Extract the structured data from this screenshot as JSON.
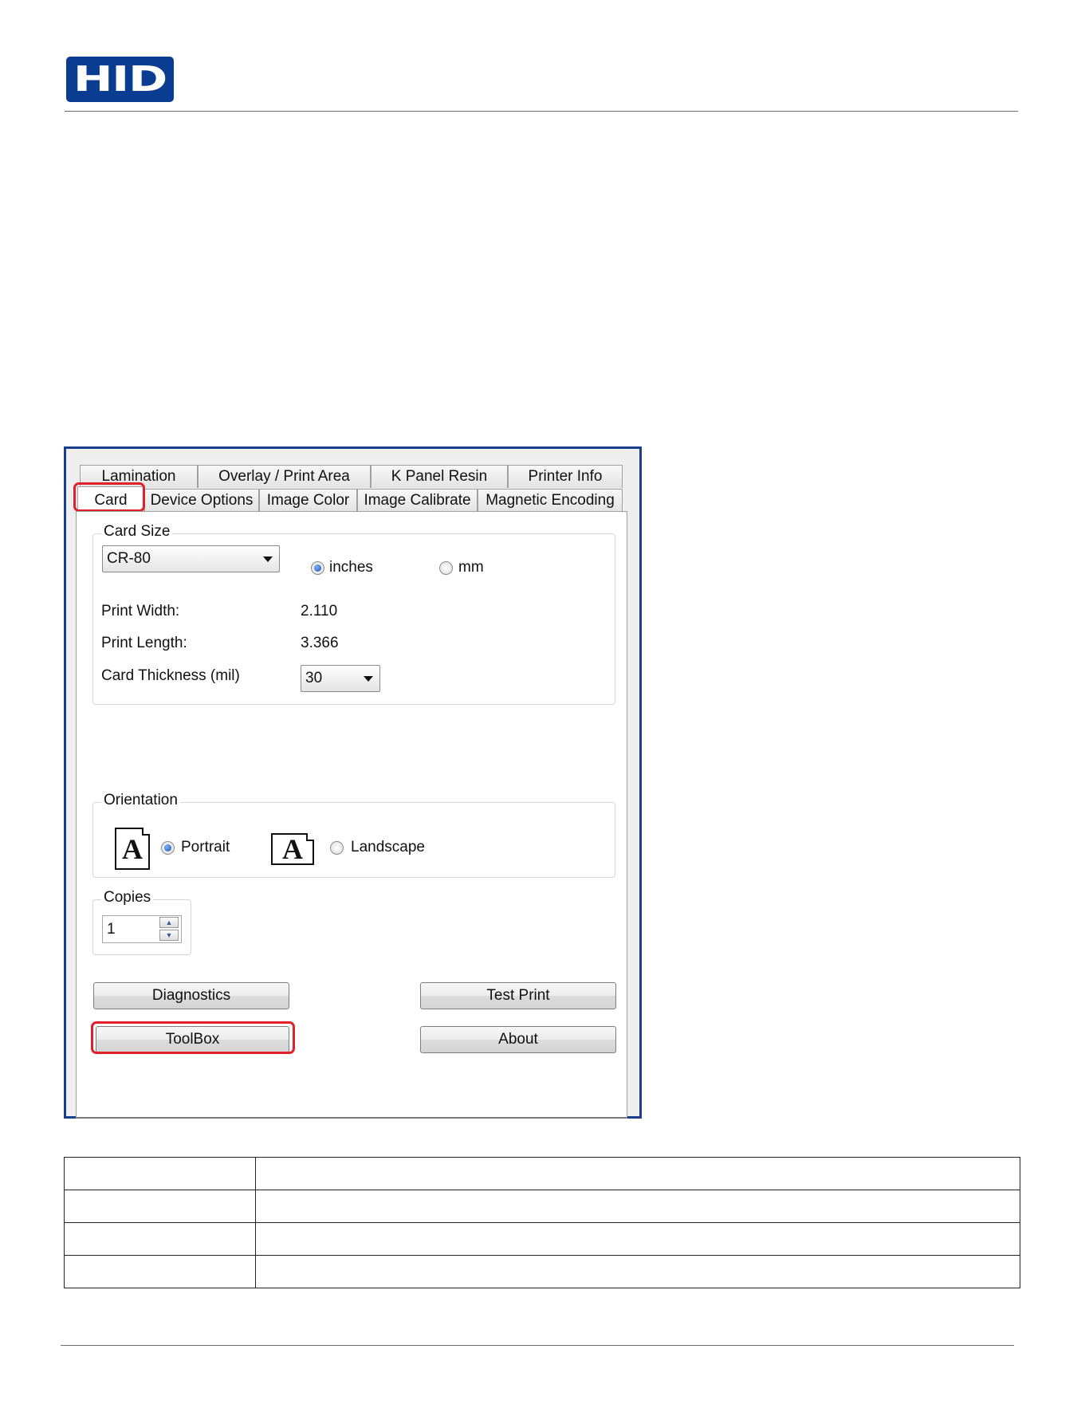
{
  "logo": {
    "text": "HID"
  },
  "tabs": {
    "row1": [
      "Lamination",
      "Overlay / Print Area",
      "K Panel Resin",
      "Printer Info"
    ],
    "row2": [
      "Card",
      "Device Options",
      "Image Color",
      "Image Calibrate",
      "Magnetic Encoding"
    ],
    "active": "Card"
  },
  "card_size": {
    "title": "Card Size",
    "selected": "CR-80",
    "unit_inches": "inches",
    "unit_mm": "mm",
    "unit_selected": "inches",
    "print_width_label": "Print Width:",
    "print_width_value": "2.110",
    "print_length_label": "Print Length:",
    "print_length_value": "3.366",
    "thickness_label": "Card Thickness (mil)",
    "thickness_value": "30"
  },
  "orientation": {
    "title": "Orientation",
    "icon_letter": "A",
    "portrait": "Portrait",
    "landscape": "Landscape",
    "selected": "Portrait"
  },
  "copies": {
    "title": "Copies",
    "value": "1"
  },
  "buttons": {
    "diagnostics": "Diagnostics",
    "test_print": "Test Print",
    "toolbox": "ToolBox",
    "about": "About"
  },
  "colors": {
    "brand": "#0a3d91",
    "highlight": "#e0202a"
  }
}
